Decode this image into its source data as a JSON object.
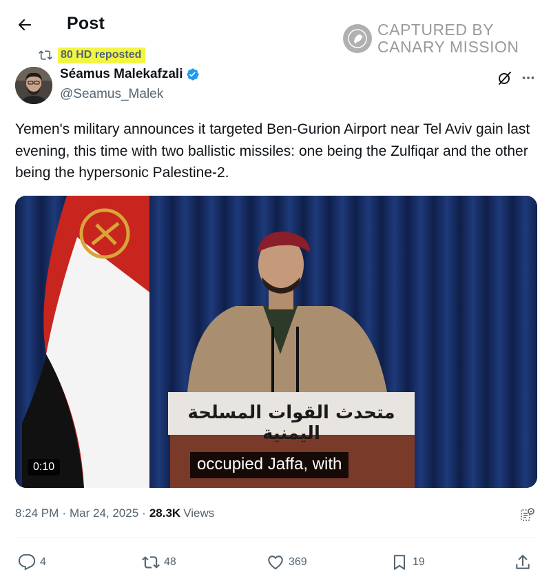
{
  "header": {
    "title": "Post",
    "back_icon": "arrow-left-icon"
  },
  "watermark": {
    "line1": "CAPTURED BY",
    "line2": "CANARY MISSION",
    "icon": "canary-bird-icon"
  },
  "repost": {
    "label": "80 HD reposted",
    "icon": "repost-icon"
  },
  "author": {
    "name": "Séamus Malekafzali",
    "handle": "@Seamus_Malek",
    "verified": true
  },
  "post": {
    "text": "Yemen's military announces it targeted Ben-Gurion Airport near Tel Aviv gain last evening, this time with two ballistic missiles: one being the Zulfiqar and the other being the hypersonic Palestine-2."
  },
  "media": {
    "type": "video",
    "duration": "0:10",
    "subtitle": "occupied Jaffa, with",
    "podium_sign": "متحدث القوات المسلحة اليمنية"
  },
  "meta": {
    "time": "8:24 PM",
    "date": "Mar 24, 2025",
    "views_count": "28.3K",
    "views_label": "Views"
  },
  "actions": {
    "replies": "4",
    "reposts": "48",
    "likes": "369",
    "bookmarks": "19"
  },
  "colors": {
    "text": "#0f1419",
    "secondary": "#536471",
    "verified": "#1d9bf0",
    "highlight": "#f2f543"
  }
}
